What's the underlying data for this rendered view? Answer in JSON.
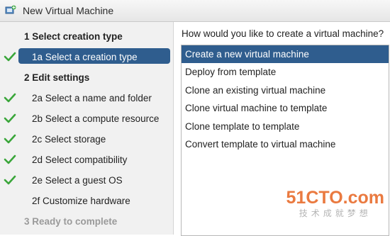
{
  "window": {
    "title": "New Virtual Machine",
    "icon": "new-vm-icon"
  },
  "steps": [
    {
      "label": "1 Select creation type",
      "type": "header",
      "checked": false,
      "selected": false,
      "disabled": false
    },
    {
      "label": "1a Select a creation type",
      "type": "sub",
      "checked": true,
      "selected": true,
      "disabled": false
    },
    {
      "label": "2 Edit settings",
      "type": "header",
      "checked": false,
      "selected": false,
      "disabled": false
    },
    {
      "label": "2a Select a name and folder",
      "type": "sub",
      "checked": true,
      "selected": false,
      "disabled": false
    },
    {
      "label": "2b Select a compute resource",
      "type": "sub",
      "checked": true,
      "selected": false,
      "disabled": false
    },
    {
      "label": "2c Select storage",
      "type": "sub",
      "checked": true,
      "selected": false,
      "disabled": false
    },
    {
      "label": "2d Select compatibility",
      "type": "sub",
      "checked": true,
      "selected": false,
      "disabled": false
    },
    {
      "label": "2e Select a guest OS",
      "type": "sub",
      "checked": true,
      "selected": false,
      "disabled": false
    },
    {
      "label": "2f Customize hardware",
      "type": "sub",
      "checked": false,
      "selected": false,
      "disabled": false
    },
    {
      "label": "3 Ready to complete",
      "type": "header",
      "checked": false,
      "selected": false,
      "disabled": true
    }
  ],
  "main": {
    "question": "How would you like to create a virtual machine?",
    "options": [
      {
        "label": "Create a new virtual machine",
        "selected": true
      },
      {
        "label": "Deploy from template",
        "selected": false
      },
      {
        "label": "Clone an existing virtual machine",
        "selected": false
      },
      {
        "label": "Clone virtual machine to template",
        "selected": false
      },
      {
        "label": "Clone template to template",
        "selected": false
      },
      {
        "label": "Convert template to virtual machine",
        "selected": false
      }
    ]
  },
  "watermark": {
    "brand": "51CTO.com",
    "tagline": "技术成就梦想"
  },
  "colors": {
    "selection": "#2f5d8e",
    "check": "#3aa63a",
    "watermark": "#e86c2c"
  }
}
